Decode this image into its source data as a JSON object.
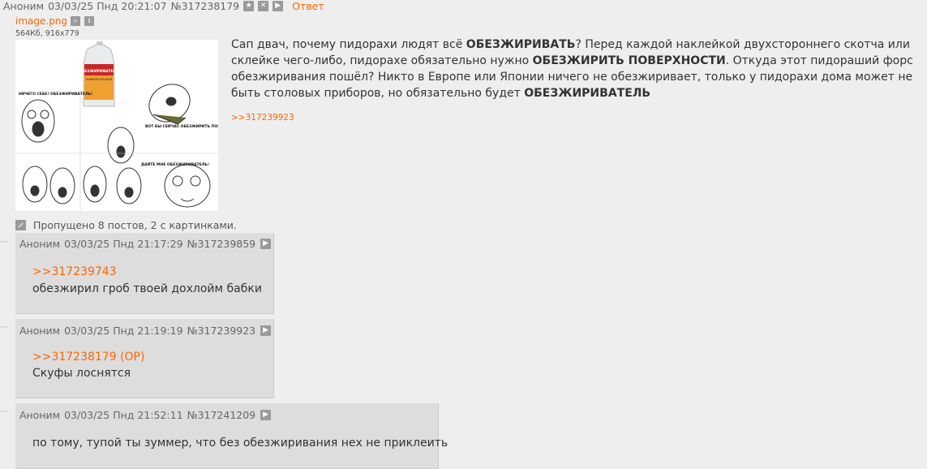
{
  "op": {
    "author": "Аноним",
    "date": "03/03/25 Пнд 20:21:07",
    "post_number": "№317238179",
    "reply_label": "Ответ",
    "file": {
      "name": "image.png",
      "meta": "564Кб, 916x779",
      "thumb_labels": {
        "bottle": "ОБЕЗЖИРИВАТЕЛЬ",
        "bottle_sub": "УНИВЕРСАЛЬНЫЙ",
        "t1": "НИЧЕГО СЕБЕ! ОБЕЗЖИРИВАТЕЛЬ!",
        "t2": "ВОТ БЫ СЕЙЧАС ОБЕЗЖИРИТЬ ПОВЕРХНОСТЬ",
        "t3": "ДАЙТЕ МНЕ ОБЕЗЖИРИВАТЕЛЬ!"
      }
    },
    "text_parts": [
      {
        "t": "Сап двач, почему пидорахи людят всё ",
        "b": false
      },
      {
        "t": "ОБЕЗЖИРИВАТЬ",
        "b": true
      },
      {
        "t": "? Перед каждой наклейкой двухстороннего скотча или склейке чего-либо, пидорахе обязательно нужно ",
        "b": false
      },
      {
        "t": "ОБЕЗЖИРИТЬ ПОВЕРХНОСТИ",
        "b": true
      },
      {
        "t": ". Откуда этот пидораший форс обезжиривания пошёл? Никто в Европе или Японии ничего не обезжиривает, только у пидорахи дома может не быть столовых приборов, но обязательно будет ",
        "b": false
      },
      {
        "t": "ОБЕЗЖИРИВАТЕЛЬ",
        "b": true
      }
    ],
    "reply_ref": ">>317239923"
  },
  "omitted": "Пропущено 8 постов, 2 с картинками.",
  "replies": [
    {
      "author": "Аноним",
      "date": "03/03/25 Пнд 21:17:29",
      "post_number": "№317239859",
      "ref": ">>317239743",
      "text": "обезжирил гроб твоей дохлойм бабки"
    },
    {
      "author": "Аноним",
      "date": "03/03/25 Пнд 21:19:19",
      "post_number": "№317239923",
      "ref": ">>317238179 (OP)",
      "text": "Скуфы лоснятся"
    },
    {
      "author": "Аноним",
      "date": "03/03/25 Пнд 21:52:11",
      "post_number": "№317241209",
      "ref": "",
      "text": "по тому, тупой ты зуммер, что без обезжиривания нех не приклеить"
    }
  ]
}
